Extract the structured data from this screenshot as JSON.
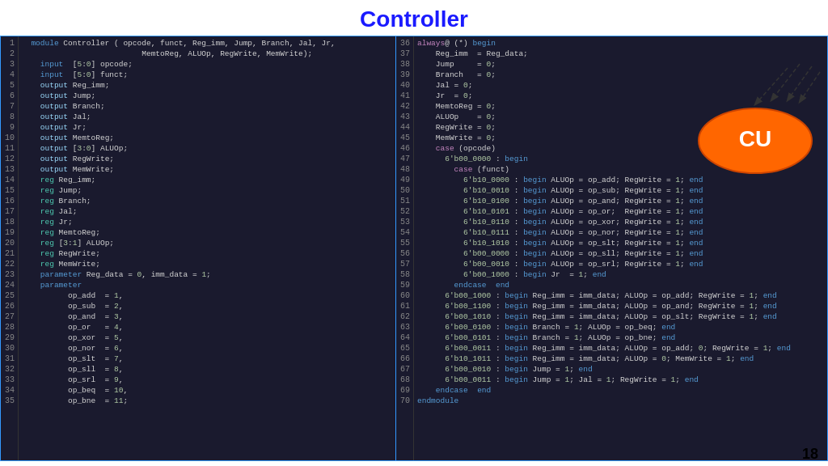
{
  "title": "Controller",
  "page_number": "18",
  "left_code": {
    "lines": [
      "1",
      "2",
      "3",
      "4",
      "5",
      "6",
      "7",
      "8",
      "9",
      "10",
      "11",
      "12",
      "13",
      "14",
      "15",
      "16",
      "17",
      "18",
      "19",
      "20",
      "21",
      "22",
      "23",
      "24",
      "25",
      "26",
      "27",
      "28",
      "29",
      "30",
      "31",
      "32",
      "33",
      "34",
      "35"
    ]
  },
  "right_code": {
    "lines": [
      "36",
      "37",
      "38",
      "39",
      "40",
      "41",
      "42",
      "43",
      "44",
      "45",
      "46",
      "47",
      "48",
      "49",
      "50",
      "51",
      "52",
      "53",
      "54",
      "55",
      "56",
      "57",
      "58",
      "59",
      "60",
      "61",
      "62",
      "63",
      "64",
      "65",
      "66",
      "67",
      "68",
      "69",
      "70"
    ]
  },
  "cu_label": "CU"
}
